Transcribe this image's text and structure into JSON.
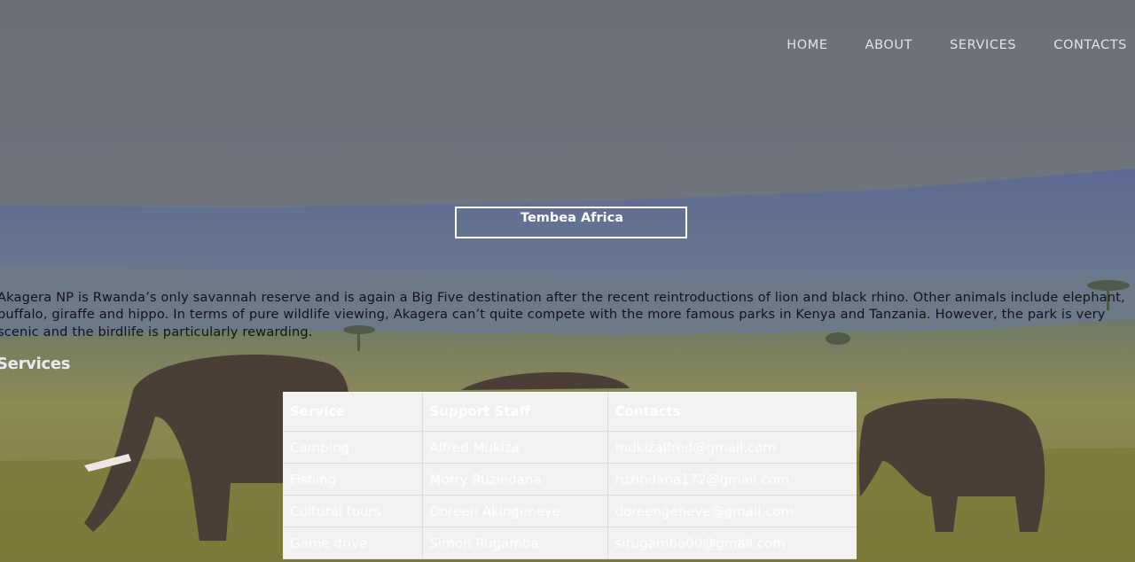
{
  "nav": {
    "items": [
      {
        "label": "HOME"
      },
      {
        "label": "ABOUT"
      },
      {
        "label": "SERVICES"
      },
      {
        "label": "CONTACTS"
      }
    ]
  },
  "brand": {
    "title": "Tembea Africa"
  },
  "intro": {
    "text": "Akagera NP is Rwanda’s only savannah reserve and is again a Big Five destination after the recent reintroductions of lion and black rhino. Other animals include elephant, buffalo, giraffe and hippo. In terms of pure wildlife viewing, Akagera can’t quite compete with the more famous parks in Kenya and Tanzania. However, the park is very scenic and the birdlife is particularly rewarding."
  },
  "services": {
    "heading": "Services",
    "columns": [
      "Service",
      "Support Staff",
      "Contacts"
    ],
    "rows": [
      [
        "Camping",
        "Alfred Mukiza",
        "mukizalfred@gmail.com"
      ],
      [
        "Fishing",
        "Morry Ruzindana",
        "ruzindana172@gmail.com"
      ],
      [
        "Cultural tours",
        "Doreen Akingeneye",
        "doreengeneye@gmail.com"
      ],
      [
        "Game drive",
        "Simon Rugamba",
        "sirugamba00@gmail.com"
      ]
    ]
  },
  "colors": {
    "sky": "#6d7079",
    "hills": "#5d6a8f",
    "grass": "#8a8548",
    "table_bg": "#f2f2f2",
    "text_light": "#ffffff"
  }
}
